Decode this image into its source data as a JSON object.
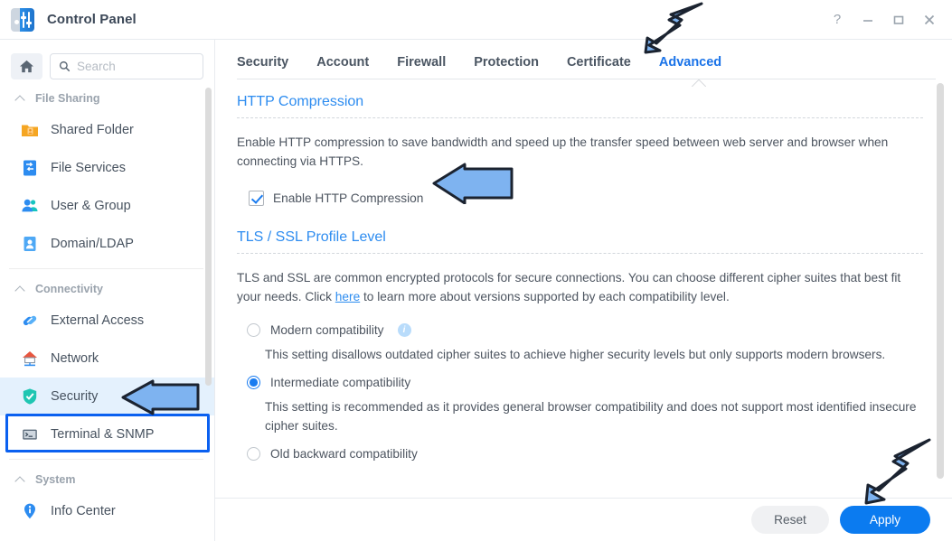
{
  "window": {
    "title": "Control Panel",
    "app_icon": "control-panel-icon",
    "help_label": "?",
    "minimize_label": "minimize",
    "maximize_label": "maximize",
    "close_label": "close"
  },
  "sidebar": {
    "home_label": "home-icon",
    "search": {
      "placeholder": "Search",
      "value": ""
    },
    "groups": [
      {
        "label": "File Sharing",
        "items": [
          {
            "label": "Shared Folder",
            "icon": "folder-icon"
          },
          {
            "label": "File Services",
            "icon": "file-services-icon"
          },
          {
            "label": "User & Group",
            "icon": "users-icon"
          },
          {
            "label": "Domain/LDAP",
            "icon": "id-card-icon"
          }
        ]
      },
      {
        "label": "Connectivity",
        "items": [
          {
            "label": "External Access",
            "icon": "link-icon"
          },
          {
            "label": "Network",
            "icon": "house-network-icon"
          },
          {
            "label": "Security",
            "icon": "shield-icon",
            "selected": true
          },
          {
            "label": "Terminal & SNMP",
            "icon": "terminal-icon"
          }
        ]
      },
      {
        "label": "System",
        "items": [
          {
            "label": "Info Center",
            "icon": "info-pin-icon"
          }
        ]
      }
    ]
  },
  "main": {
    "tabs": [
      {
        "label": "Security",
        "active": false
      },
      {
        "label": "Account",
        "active": false
      },
      {
        "label": "Firewall",
        "active": false
      },
      {
        "label": "Protection",
        "active": false
      },
      {
        "label": "Certificate",
        "active": false
      },
      {
        "label": "Advanced",
        "active": true
      }
    ],
    "http_compression": {
      "title": "HTTP Compression",
      "description": "Enable HTTP compression to save bandwidth and speed up the transfer speed between web server and browser when connecting via HTTPS.",
      "checkbox_label": "Enable HTTP Compression",
      "checked": true
    },
    "tls_ssl": {
      "title": "TLS / SSL Profile Level",
      "description_before_link": "TLS and SSL are common encrypted protocols for secure connections. You can choose different cipher suites that best fit your needs. Click ",
      "link_text": "here",
      "description_after_link": " to learn more about versions supported by each compatibility level.",
      "options": [
        {
          "label": "Modern compatibility",
          "selected": false,
          "has_info": true,
          "description": "This setting disallows outdated cipher suites to achieve higher security levels but only supports modern browsers."
        },
        {
          "label": "Intermediate compatibility",
          "selected": true,
          "has_info": false,
          "description": "This setting is recommended as it provides general browser compatibility and does not support most identified insecure cipher suites."
        },
        {
          "label": "Old backward compatibility",
          "selected": false,
          "has_info": false,
          "description": ""
        }
      ]
    }
  },
  "footer": {
    "reset_label": "Reset",
    "apply_label": "Apply"
  },
  "colors": {
    "accent_blue": "#0b7bf0",
    "link_blue": "#2d8cf0",
    "annotation_blue": "#7eb3f0",
    "annotation_outline": "#1b2330",
    "highlight_border": "#0a60f0",
    "selected_row_bg": "#e4f1fd"
  }
}
